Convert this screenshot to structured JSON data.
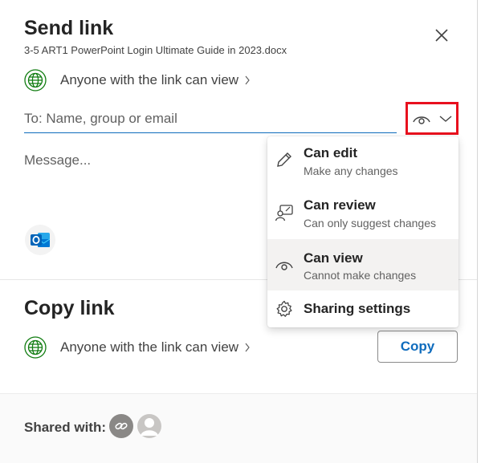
{
  "dialog": {
    "title": "Send link",
    "filename": "3-5 ART1 PowerPoint Login Ultimate Guide in 2023.docx",
    "close_icon": "close-icon"
  },
  "send": {
    "permission_text": "Anyone with the link can view",
    "to_placeholder": "To: Name, group or email",
    "to_value": "",
    "permission_toggle_icon": "eye-icon",
    "permission_toggle_highlight": "#e8101e",
    "message_placeholder": "Message...",
    "message_value": "",
    "outlook_icon": "outlook-icon"
  },
  "copy": {
    "title": "Copy link",
    "permission_text": "Anyone with the link can view",
    "button_label": "Copy"
  },
  "shared": {
    "label": "Shared with:",
    "avatars": [
      "link-icon",
      "person-icon"
    ]
  },
  "menu": {
    "items": [
      {
        "title": "Can edit",
        "subtitle": "Make any changes",
        "icon": "pencil-icon",
        "selected": false
      },
      {
        "title": "Can review",
        "subtitle": "Can only suggest changes",
        "icon": "review-icon",
        "selected": false
      },
      {
        "title": "Can view",
        "subtitle": "Cannot make changes",
        "icon": "eye-icon",
        "selected": true
      },
      {
        "title": "Sharing settings",
        "subtitle": "",
        "icon": "gear-icon",
        "selected": false
      }
    ]
  },
  "colors": {
    "accent": "#0f6cbd",
    "globe_green": "#107c10",
    "highlight_red": "#e8101e"
  }
}
